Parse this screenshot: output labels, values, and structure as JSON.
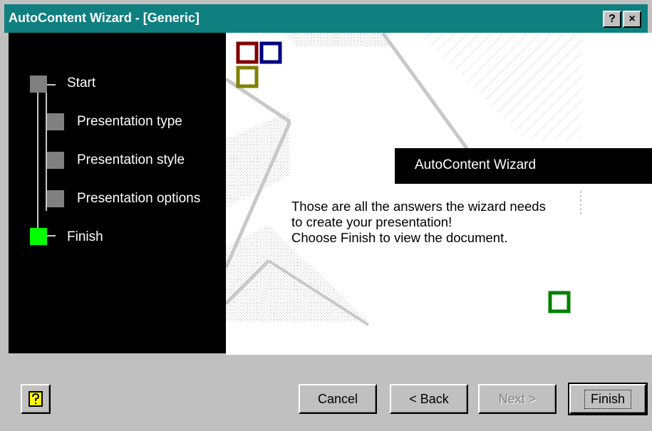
{
  "window": {
    "title": "AutoContent Wizard - [Generic]",
    "help_glyph": "?",
    "close_glyph": "×",
    "titlebar_color": "#0f7f80"
  },
  "steps": [
    {
      "label": "Start",
      "status": "done",
      "color": "#808080"
    },
    {
      "label": "Presentation type",
      "status": "done",
      "color": "#808080"
    },
    {
      "label": "Presentation style",
      "status": "done",
      "color": "#808080"
    },
    {
      "label": "Presentation options",
      "status": "done",
      "color": "#808080"
    },
    {
      "label": "Finish",
      "status": "current",
      "color": "#00ff00"
    }
  ],
  "panel": {
    "heading": "AutoContent Wizard",
    "message": "Those are all the answers the wizard needs\nto create your presentation!\nChoose Finish to view the document."
  },
  "buttons": {
    "help_icon": "question-mark-icon",
    "cancel": "Cancel",
    "back": "< Back",
    "next": "Next >",
    "finish": "Finish"
  },
  "decor_colors": {
    "maroon": "#800000",
    "navy": "#000080",
    "olive": "#808000",
    "green": "#008000"
  }
}
